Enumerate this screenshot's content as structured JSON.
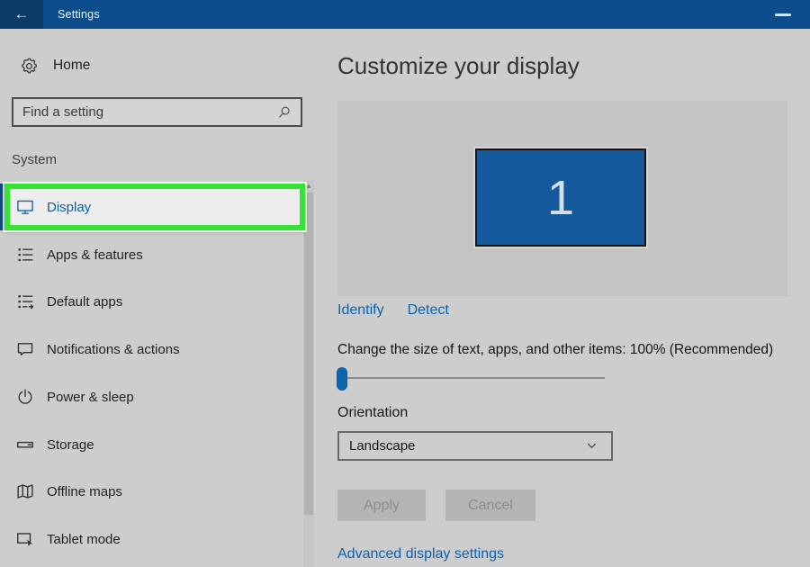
{
  "titlebar": {
    "title": "Settings",
    "back_glyph": "←",
    "minimize_icon": "minimize-icon"
  },
  "sidebar": {
    "home_label": "Home",
    "home_icon": "gear-icon",
    "search_placeholder": "Find a setting",
    "search_icon": "search-icon",
    "section_label": "System",
    "items": [
      {
        "label": "Display",
        "icon": "display-icon",
        "selected": true
      },
      {
        "label": "Apps & features",
        "icon": "apps-icon",
        "selected": false
      },
      {
        "label": "Default apps",
        "icon": "default-apps-icon",
        "selected": false
      },
      {
        "label": "Notifications & actions",
        "icon": "notifications-icon",
        "selected": false
      },
      {
        "label": "Power & sleep",
        "icon": "power-icon",
        "selected": false
      },
      {
        "label": "Storage",
        "icon": "storage-icon",
        "selected": false
      },
      {
        "label": "Offline maps",
        "icon": "offline-maps-icon",
        "selected": false
      },
      {
        "label": "Tablet mode",
        "icon": "tablet-mode-icon",
        "selected": false
      }
    ]
  },
  "content": {
    "heading": "Customize your display",
    "monitor_number": "1",
    "identify_link": "Identify",
    "detect_link": "Detect",
    "scale_text": "Change the size of text, apps, and other items: 100% (Recommended)",
    "orientation_label": "Orientation",
    "orientation_value": "Landscape",
    "orientation_chevron": "chevron-down-icon",
    "apply_label": "Apply",
    "cancel_label": "Cancel",
    "advanced_link": "Advanced display settings"
  },
  "annotation": {
    "type": "highlight-box",
    "color": "#35e335"
  },
  "colors": {
    "titlebar": "#0e4d8c",
    "back_button": "#0c3a66",
    "app_background": "#cdcdcd",
    "preview_panel": "#c4c4c4",
    "selected_row": "#ededed",
    "accent_blue": "#0f63a8",
    "link_blue": "#0a62ad",
    "monitor_fill": "#14599c",
    "highlight_green": "#35e335",
    "disabled_button": "#b5b5b5"
  }
}
